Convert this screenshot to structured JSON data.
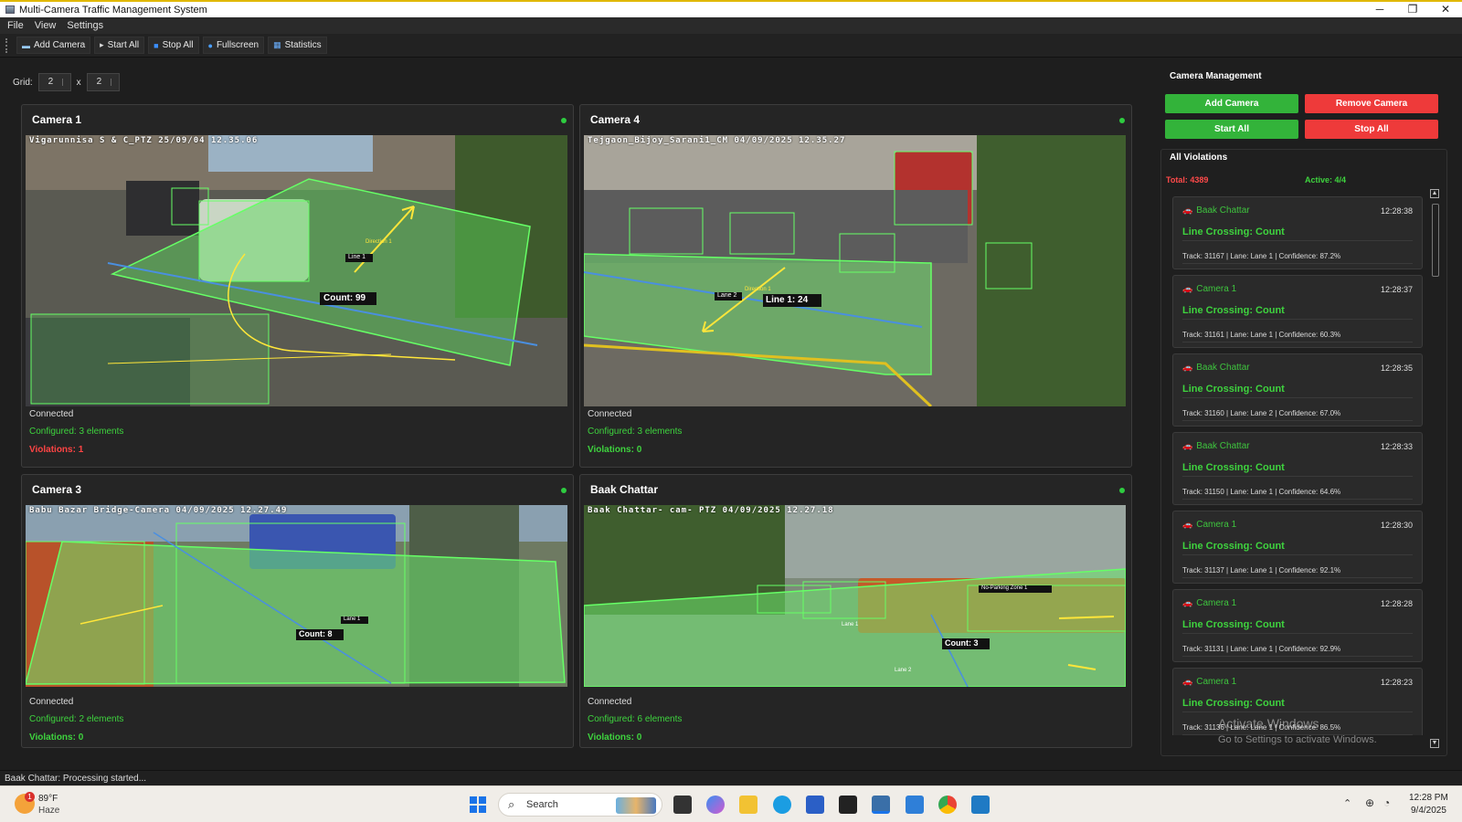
{
  "window": {
    "title": "Multi-Camera Traffic Management System",
    "controls": [
      "─",
      "❐",
      "✕"
    ]
  },
  "menu": [
    "File",
    "View",
    "Settings"
  ],
  "toolbar": [
    {
      "icon": "camera-icon",
      "glyph": "▬",
      "label": "Add Camera"
    },
    {
      "icon": "play-icon",
      "glyph": "▸",
      "label": "Start All"
    },
    {
      "icon": "stop-icon",
      "glyph": "■",
      "label": "Stop All"
    },
    {
      "icon": "magnifier-icon",
      "glyph": "●",
      "label": "Fullscreen"
    },
    {
      "icon": "chart-icon",
      "glyph": "▦",
      "label": "Statistics"
    }
  ],
  "grid": {
    "label": "Grid:",
    "rows": "2",
    "sep": "x",
    "cols": "2"
  },
  "cameras": [
    {
      "name": "Camera 1",
      "osd": "Vigarunnisa S & C_PTZ  25/09/04  12.35.06",
      "status": "Connected",
      "configured": "Configured: 3 elements",
      "violations": "Violations: 1",
      "violations_color": "#ff4444",
      "count_label": "Count: 99",
      "line_label": "Line 1",
      "dir_label": "Direction 1"
    },
    {
      "name": "Camera 4",
      "osd": "Tejgaon_Bijoy_Sarani1_CM  04/09/2025  12.35.27",
      "status": "Connected",
      "configured": "Configured: 3 elements",
      "violations": "Violations: 0",
      "violations_color": "#3ed33e",
      "count_label": "Line 1: 24",
      "line_label": "Lane 2",
      "dir_label": "Direction 1"
    },
    {
      "name": "Camera 3",
      "osd": "Babu Bazar Bridge-Camera  04/09/2025  12.27.49",
      "status": "Connected",
      "configured": "Configured: 2 elements",
      "violations": "Violations: 0",
      "violations_color": "#3ed33e",
      "count_label": "Count: 8",
      "line_label": "Lane 1",
      "dir_label": ""
    },
    {
      "name": "Baak Chattar",
      "osd": "Baak Chattar- cam- PTZ  04/09/2025  12.27.18",
      "status": "Connected",
      "configured": "Configured: 6 elements",
      "violations": "Violations: 0",
      "violations_color": "#3ed33e",
      "count_label": "Count: 3",
      "line_label": "Lane 1",
      "dir_label": "No-Parking Zone 1",
      "extra_label": "Lane 2"
    }
  ],
  "side": {
    "title": "Camera Management",
    "buttons": {
      "add": "Add Camera",
      "remove": "Remove Camera",
      "start": "Start All",
      "stop": "Stop All"
    },
    "violations_title": "All Violations",
    "total": "Total: 4389",
    "active": "Active: 4/4"
  },
  "violations": [
    {
      "camera": "Baak Chattar",
      "time": "12:28:38",
      "type": "Line Crossing: Count",
      "detail": "Track: 31167 | Lane: Lane 1 | Confidence: 87.2%"
    },
    {
      "camera": "Camera 1",
      "time": "12:28:37",
      "type": "Line Crossing: Count",
      "detail": "Track: 31161 | Lane: Lane 1 | Confidence: 60.3%"
    },
    {
      "camera": "Baak Chattar",
      "time": "12:28:35",
      "type": "Line Crossing: Count",
      "detail": "Track: 31160 | Lane: Lane 2 | Confidence: 67.0%"
    },
    {
      "camera": "Baak Chattar",
      "time": "12:28:33",
      "type": "Line Crossing: Count",
      "detail": "Track: 31150 | Lane: Lane 1 | Confidence: 64.6%"
    },
    {
      "camera": "Camera 1",
      "time": "12:28:30",
      "type": "Line Crossing: Count",
      "detail": "Track: 31137 | Lane: Lane 1 | Confidence: 92.1%"
    },
    {
      "camera": "Camera 1",
      "time": "12:28:28",
      "type": "Line Crossing: Count",
      "detail": "Track: 31131 | Lane: Lane 1 | Confidence: 92.9%"
    },
    {
      "camera": "Camera 1",
      "time": "12:28:23",
      "type": "Line Crossing: Count",
      "detail": "Track: 31136 | Lane: Lane 1 | Confidence: 86.5%"
    }
  ],
  "statusbar": "Baak Chattar: Processing started...",
  "watermark": {
    "line1": "Activate Windows",
    "line2": "Go to Settings to activate Windows."
  },
  "taskbar": {
    "weather_temp": "89°F",
    "weather_desc": "Haze",
    "badge": "1",
    "search_placeholder": "Search",
    "time": "12:28 PM",
    "date": "9/4/2025"
  }
}
